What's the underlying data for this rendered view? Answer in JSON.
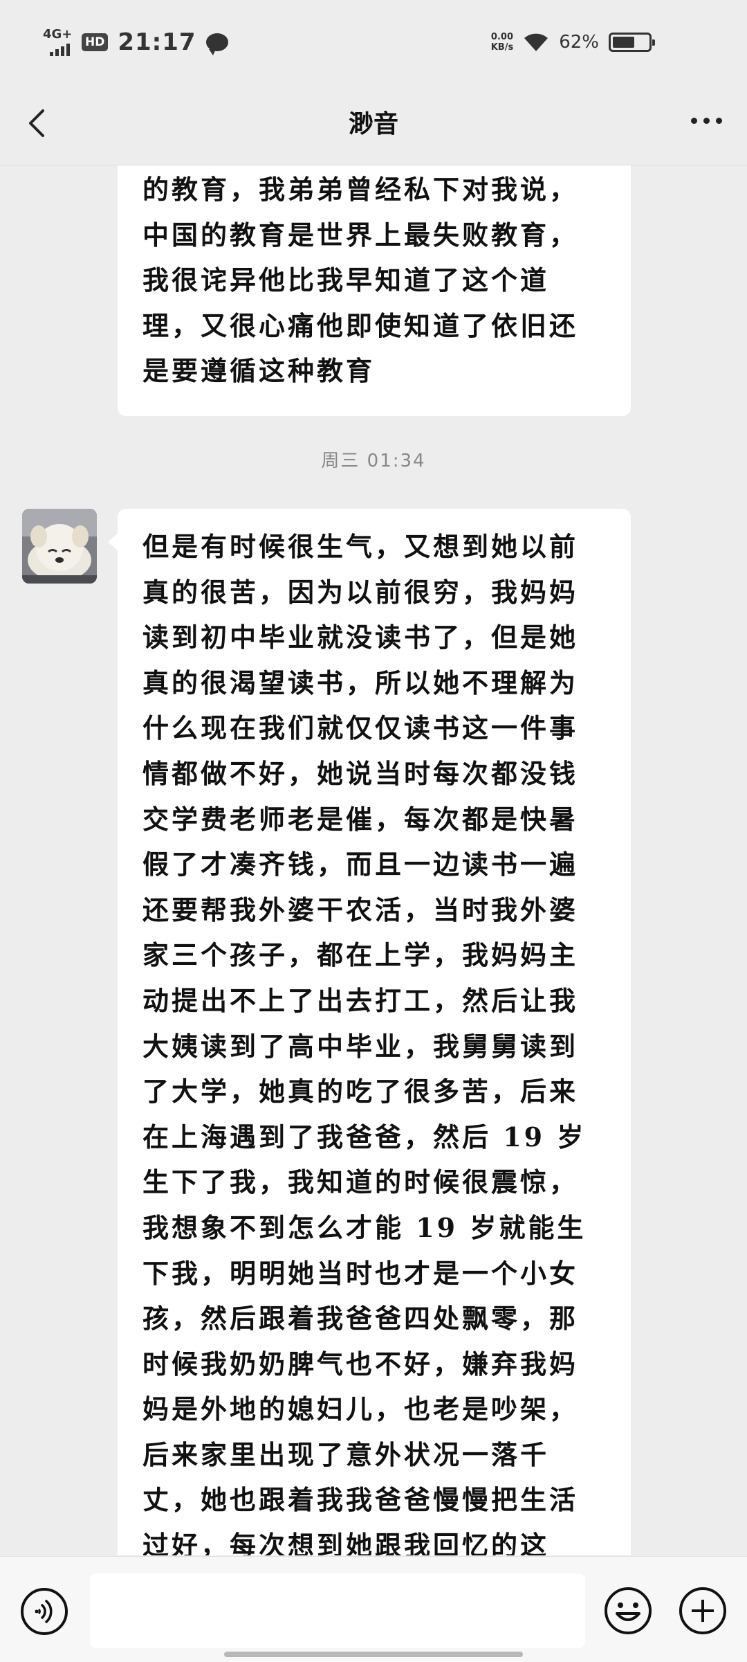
{
  "status_bar": {
    "network": "4G+",
    "hd": "HD",
    "time": "21:17",
    "net_speed_value": "0.00",
    "net_speed_unit": "KB/s",
    "battery_percent": "62%",
    "battery_level": 0.62
  },
  "nav": {
    "title": "渺音"
  },
  "messages": {
    "previous_lines": [
      "的教育，我弟弟曾经私下对我说，",
      "中国的教育是世界上最失败教育，",
      "我很诧异他比我早知道了这个道",
      "理，又很心痛他即使知道了依旧还",
      "是要遵循这种教育"
    ],
    "timestamp": "周三 01:34",
    "main_lines": [
      "但是有时候很生气，又想到她以前",
      "真的很苦，因为以前很穷，我妈妈",
      "读到初中毕业就没读书了，但是她",
      "真的很渴望读书，所以她不理解为",
      "什么现在我们就仅仅读书这一件事",
      "情都做不好，她说当时每次都没钱",
      "交学费老师老是催，每次都是快暑",
      "假了才凑齐钱，而且一边读书一遍",
      "还要帮我外婆干农活，当时我外婆",
      "家三个孩子，都在上学，我妈妈主",
      "动提出不上了出去打工，然后让我",
      "大姨读到了高中毕业，我舅舅读到",
      "了大学，她真的吃了很多苦，后来",
      "在上海遇到了我爸爸，然后 19 岁",
      "生下了我，我知道的时候很震惊，",
      "我想象不到怎么才能 19 岁就能生",
      "下我，明明她当时也才是一个小女",
      "孩，然后跟着我爸爸四处飘零，那",
      "时候我奶奶脾气也不好，嫌弃我妈",
      "妈是外地的媳妇儿，也老是吵架，",
      "后来家里出现了意外状况一落千",
      "丈，她也跟着我我爸爸慢慢把生活",
      "过好，每次想到她跟我回忆的这"
    ]
  },
  "input": {
    "placeholder": ""
  }
}
